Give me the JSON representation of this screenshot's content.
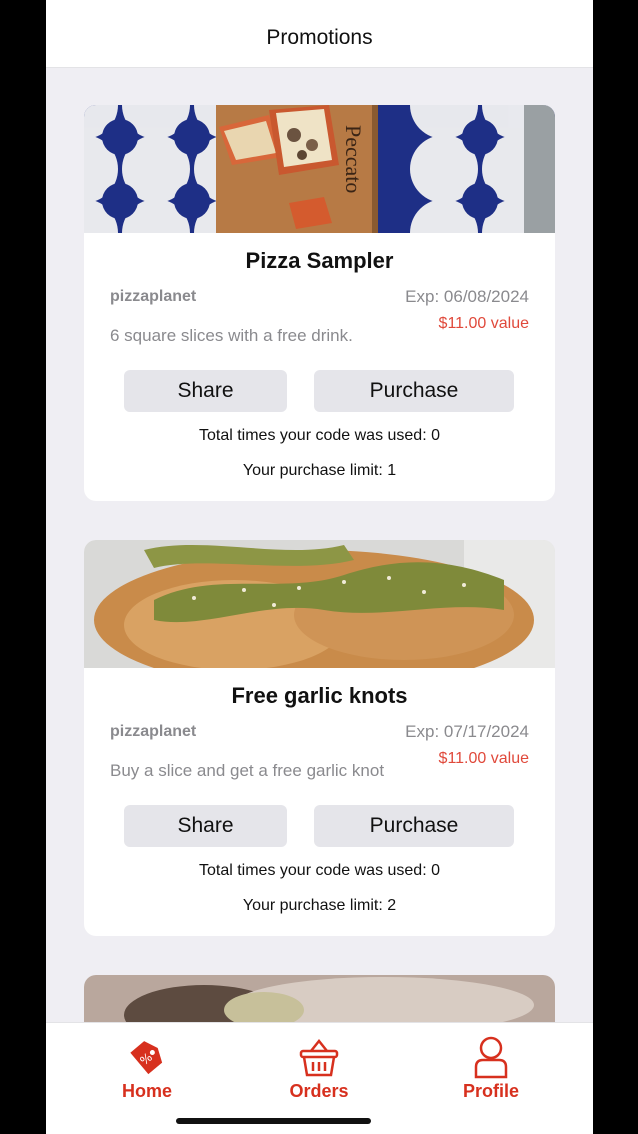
{
  "header": {
    "title": "Promotions"
  },
  "promotions": [
    {
      "title": "Pizza Sampler",
      "merchant": "pizzaplanet",
      "expires": "Exp: 06/08/2024",
      "value": "$11.00 value",
      "description": "6 square slices with a free drink.",
      "share_label": "Share",
      "purchase_label": "Purchase",
      "times_used": "Total times your code was used: 0",
      "purchase_limit": "Your purchase limit: 1",
      "board_text": "Peccato"
    },
    {
      "title": "Free garlic knots",
      "merchant": "pizzaplanet",
      "expires": "Exp: 07/17/2024",
      "value": "$11.00 value",
      "description": "Buy a slice and get a free garlic knot",
      "share_label": "Share",
      "purchase_label": "Purchase",
      "times_used": "Total times your code was used: 0",
      "purchase_limit": "Your purchase limit: 2"
    }
  ],
  "tabbar": {
    "items": [
      {
        "label": "Home",
        "icon": "tag-icon"
      },
      {
        "label": "Orders",
        "icon": "basket-icon"
      },
      {
        "label": "Profile",
        "icon": "person-icon"
      }
    ]
  },
  "colors": {
    "accent": "#d7301e",
    "value": "#e0493b",
    "background": "#efeef3"
  }
}
